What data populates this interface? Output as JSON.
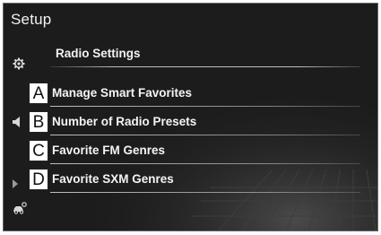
{
  "screen": {
    "title": "Setup"
  },
  "sidebar": {
    "icons": [
      {
        "name": "gear-icon"
      },
      {
        "name": "speaker-icon"
      },
      {
        "name": "chevron-right-icon"
      },
      {
        "name": "car-settings-icon"
      }
    ]
  },
  "main": {
    "heading": "Radio Settings",
    "items": [
      {
        "badge": "A",
        "label": "Manage Smart Favorites"
      },
      {
        "badge": "B",
        "label": "Number of Radio Presets"
      },
      {
        "badge": "C",
        "label": "Favorite FM Genres"
      },
      {
        "badge": "D",
        "label": "Favorite SXM Genres"
      }
    ]
  },
  "colors": {
    "background": "#1c1c1c",
    "text": "#f2f2f2",
    "badge_bg": "#ffffff"
  }
}
